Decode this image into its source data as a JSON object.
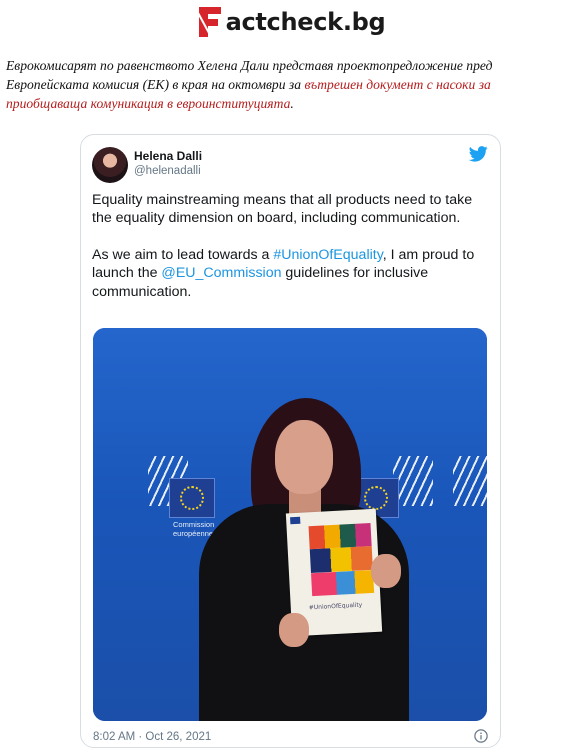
{
  "header": {
    "logo_text": "actcheck.bg",
    "brand_color": "#d6262b"
  },
  "article": {
    "text_before": "Еврокомисарят по равенството Хелена Дали представя проектопредложение пред Европейската комисия (ЕК) в края на октомври за ",
    "link_text": "вътрешен документ с насоки за приобщаваща комуникация в евроинституцията",
    "text_after": ".",
    "link_color": "#b51c1c"
  },
  "tweet": {
    "author_name": "Helena Dalli",
    "author_handle": "@helenadalli",
    "icon": "twitter-bird-icon",
    "paragraph1": "Equality mainstreaming means that all products need to take the equality dimension on board, including communication.",
    "paragraph2_before": "As we aim to lead towards a ",
    "hashtag": "#UnionOfEquality",
    "paragraph2_middle": ", I am proud to launch the ",
    "mention": "@EU_Commission",
    "paragraph2_after": " guidelines for inclusive communication.",
    "timestamp": "8:02 AM · Oct 26, 2021",
    "info_icon": "info-icon",
    "link_color": "#1b95e0",
    "photo": {
      "backdrop_text_line1": "Commission",
      "backdrop_text_line2": "européenne",
      "booklet_tag": "#UnionOfEquality"
    }
  }
}
